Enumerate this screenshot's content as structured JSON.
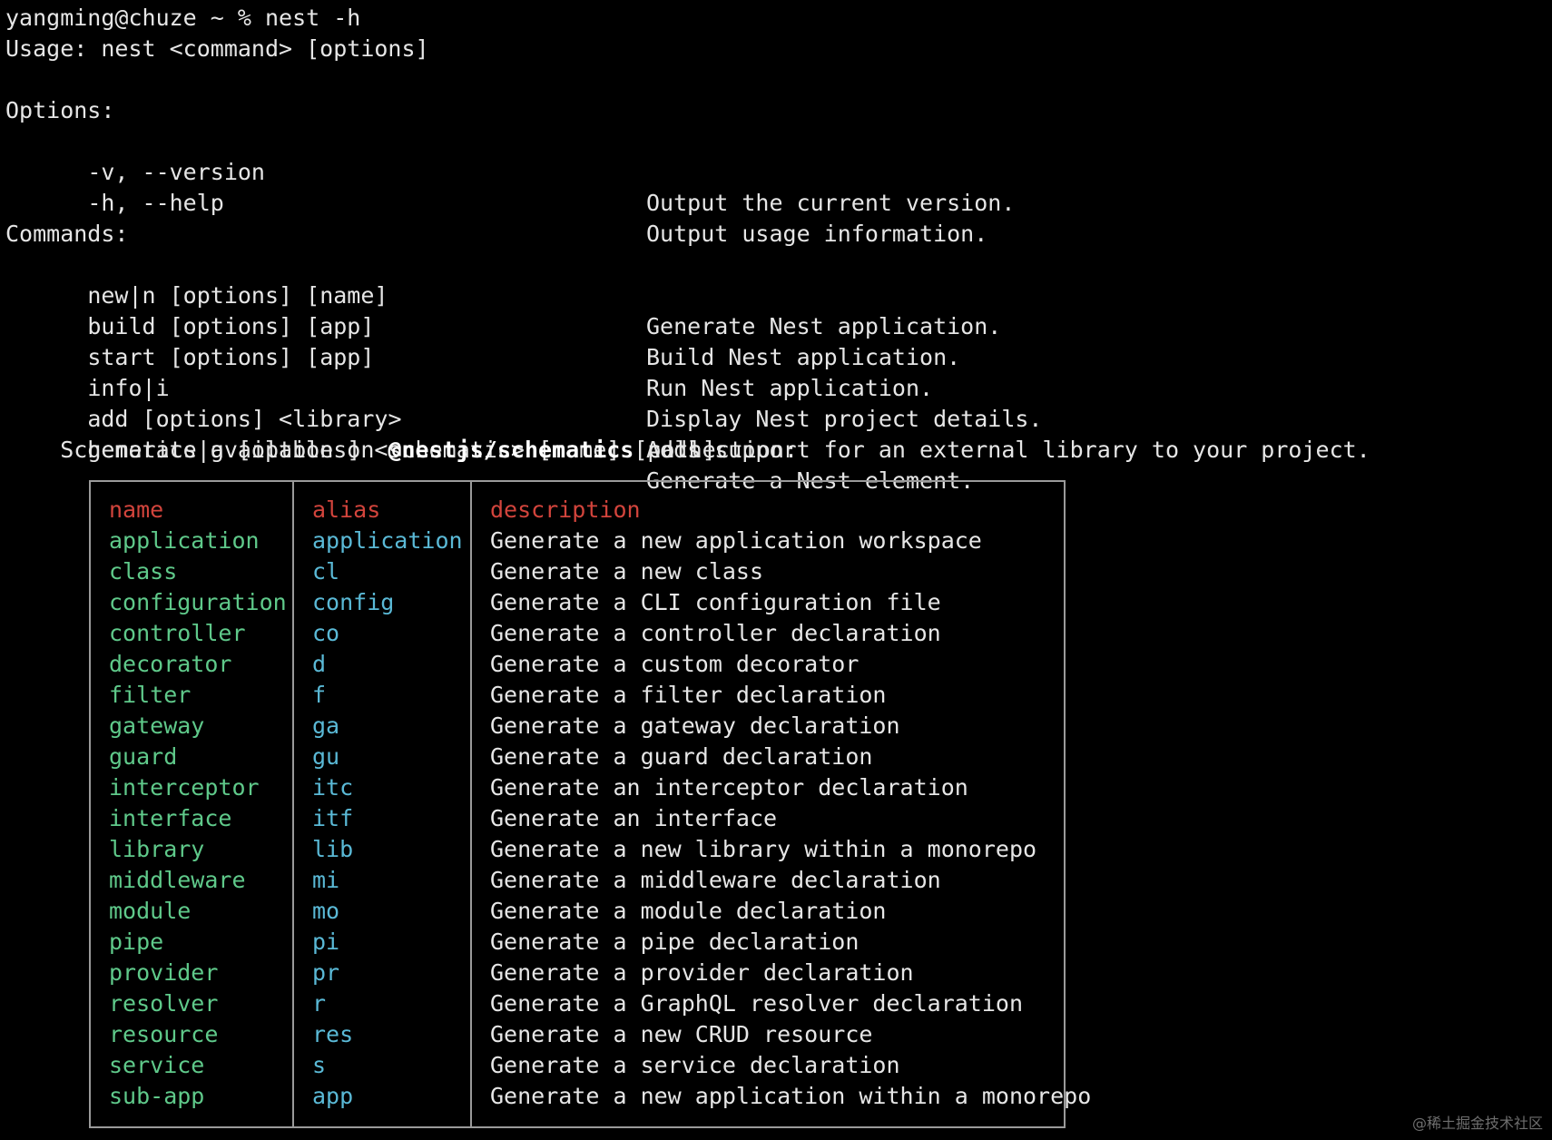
{
  "terminal": {
    "prompt_line": "yangming@chuze ~ % nest -h",
    "usage_line": "Usage: nest <command> [options]",
    "options_header": "Options:",
    "options": [
      {
        "flag": "  -v, --version",
        "desc": "Output the current version."
      },
      {
        "flag": "  -h, --help",
        "desc": "Output usage information."
      }
    ],
    "commands_header": "Commands:",
    "commands": [
      {
        "cmd": "  new|n [options] [name]",
        "desc": "Generate Nest application."
      },
      {
        "cmd": "  build [options] [app]",
        "desc": "Build Nest application."
      },
      {
        "cmd": "  start [options] [app]",
        "desc": "Run Nest application."
      },
      {
        "cmd": "  info|i",
        "desc": "Display Nest project details."
      },
      {
        "cmd": "  add [options] <library>",
        "desc": "Adds support for an external library to your project."
      },
      {
        "cmd": "  generate|g [options] <schematic> [name] [path]",
        "desc": "Generate a Nest element."
      }
    ],
    "schematics_prefix": "    Schematics available on ",
    "schematics_collection": "@nestjs/schematics",
    "schematics_suffix": " collection:"
  },
  "table": {
    "headers": {
      "name": "name",
      "alias": "alias",
      "description": "description"
    },
    "rows": [
      {
        "name": "application",
        "alias": "application",
        "description": "Generate a new application workspace"
      },
      {
        "name": "class",
        "alias": "cl",
        "description": "Generate a new class"
      },
      {
        "name": "configuration",
        "alias": "config",
        "description": "Generate a CLI configuration file"
      },
      {
        "name": "controller",
        "alias": "co",
        "description": "Generate a controller declaration"
      },
      {
        "name": "decorator",
        "alias": "d",
        "description": "Generate a custom decorator"
      },
      {
        "name": "filter",
        "alias": "f",
        "description": "Generate a filter declaration"
      },
      {
        "name": "gateway",
        "alias": "ga",
        "description": "Generate a gateway declaration"
      },
      {
        "name": "guard",
        "alias": "gu",
        "description": "Generate a guard declaration"
      },
      {
        "name": "interceptor",
        "alias": "itc",
        "description": "Generate an interceptor declaration"
      },
      {
        "name": "interface",
        "alias": "itf",
        "description": "Generate an interface"
      },
      {
        "name": "library",
        "alias": "lib",
        "description": "Generate a new library within a monorepo"
      },
      {
        "name": "middleware",
        "alias": "mi",
        "description": "Generate a middleware declaration"
      },
      {
        "name": "module",
        "alias": "mo",
        "description": "Generate a module declaration"
      },
      {
        "name": "pipe",
        "alias": "pi",
        "description": "Generate a pipe declaration"
      },
      {
        "name": "provider",
        "alias": "pr",
        "description": "Generate a provider declaration"
      },
      {
        "name": "resolver",
        "alias": "r",
        "description": "Generate a GraphQL resolver declaration"
      },
      {
        "name": "resource",
        "alias": "res",
        "description": "Generate a new CRUD resource"
      },
      {
        "name": "service",
        "alias": "s",
        "description": "Generate a service declaration"
      },
      {
        "name": "sub-app",
        "alias": "app",
        "description": "Generate a new application within a monorepo"
      }
    ]
  },
  "colors": {
    "background": "#000000",
    "text": "#e6e6e6",
    "header": "#d2443c",
    "name": "#5fc98a",
    "alias": "#5ab9d6",
    "border": "#9a9a9a"
  },
  "watermark": "@稀土掘金技术社区"
}
